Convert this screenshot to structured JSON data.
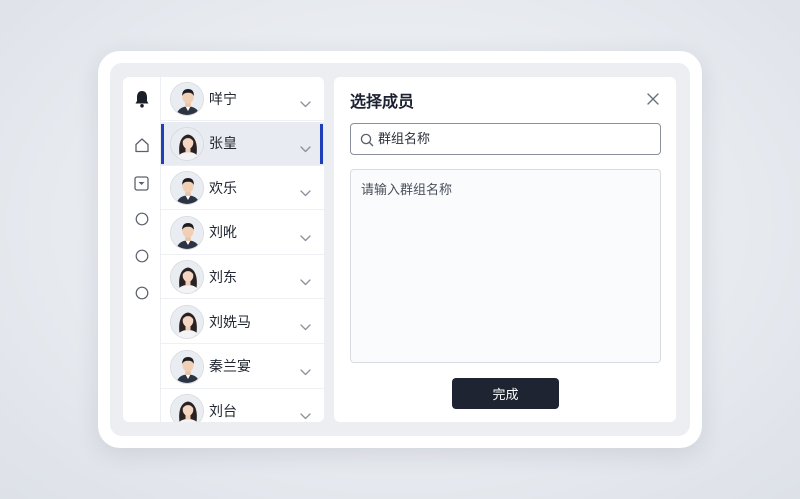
{
  "panel": {
    "title": "选择成员",
    "search_placeholder": "群组名称",
    "textarea_placeholder": "请输入群组名称",
    "done_label": "完成"
  },
  "contacts": [
    {
      "name": "咩宁",
      "avatar": "male",
      "selected": false
    },
    {
      "name": "张皇",
      "avatar": "female",
      "selected": true
    },
    {
      "name": "欢乐",
      "avatar": "male",
      "selected": false
    },
    {
      "name": "刘吪",
      "avatar": "male",
      "selected": false
    },
    {
      "name": "刘东",
      "avatar": "female",
      "selected": false
    },
    {
      "name": "刘姺马",
      "avatar": "female",
      "selected": false
    },
    {
      "name": "秦兰宴",
      "avatar": "male",
      "selected": false
    },
    {
      "name": "刘台",
      "avatar": "female",
      "selected": false
    }
  ],
  "rail_icons": [
    "bell-icon",
    "home-icon",
    "inbox-icon",
    "circle-icon",
    "circle-icon",
    "circle-icon"
  ],
  "colors": {
    "accent": "#1f3fb8",
    "button": "#1e2431",
    "selected_row": "#e8ebf1"
  }
}
